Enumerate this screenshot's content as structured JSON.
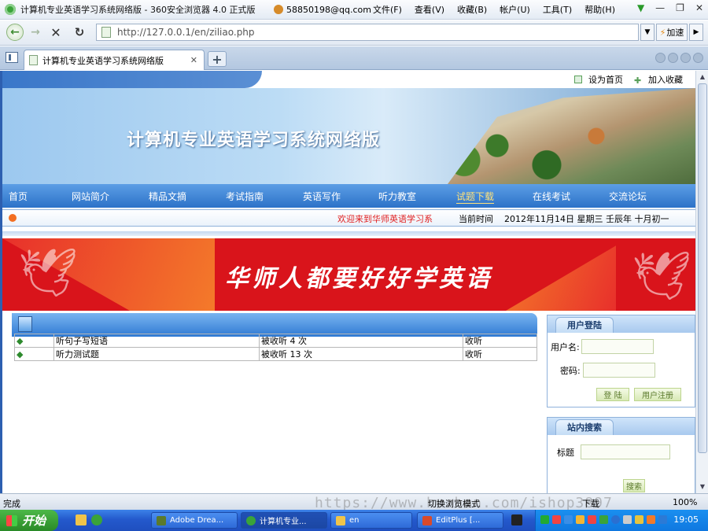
{
  "window": {
    "title": "计算机专业英语学习系统网络版 - 360安全浏览器 4.0 正式版",
    "account": "58850198@qq.com",
    "menu": [
      "文件(F)",
      "查看(V)",
      "收藏(B)",
      "帐户(U)",
      "工具(T)",
      "帮助(H)"
    ]
  },
  "addressbar": {
    "url": "http://127.0.0.1/en/ziliao.php",
    "accelerate_label": "加速"
  },
  "tabs": [
    {
      "label": "计算机专业英语学习系统网络版"
    }
  ],
  "page": {
    "top_links": {
      "set_home": "设为首页",
      "add_favorite": "加入收藏"
    },
    "site_title": "计算机专业英语学习系统网络版",
    "nav": [
      "首页",
      "网站简介",
      "精品文摘",
      "考试指南",
      "英语写作",
      "听力教室",
      "试题下载",
      "在线考试",
      "交流论坛"
    ],
    "active_nav": "试题下载",
    "welcome_marquee": "欢迎来到华师英语学习系",
    "clock_label": "当前时间",
    "clock_value": "2012年11月14日 星期三 壬辰年 十月初一",
    "slogan": "华师人都要好好学英语",
    "list_rows": [
      {
        "bullet": "◆",
        "name": "听句子写短语",
        "count": "被收听 4 次",
        "action": "收听"
      },
      {
        "bullet": "◆",
        "name": "听力测试题",
        "count": "被收听 13 次",
        "action": "收听"
      }
    ],
    "login": {
      "heading": "用户登陆",
      "username_label": "用户名:",
      "password_label": "密码:",
      "login_button": "登 陆",
      "register_button": "用户注册"
    },
    "site_search": {
      "heading": "站内搜索",
      "title_label": "标题",
      "search_button": "搜索"
    }
  },
  "statusbar": {
    "status": "完成",
    "watermark": "https://www.huzhan.com/ishop3897",
    "compat_mode": "切换浏览模式",
    "download": "下载",
    "zoom": "100%"
  },
  "taskbar": {
    "start": "开始",
    "tasks": [
      "Adobe Drea...",
      "计算机专业...",
      "en",
      "EditPlus [..."
    ],
    "clock": "19:05"
  },
  "colors": {
    "nav_blue": "#2c72c8",
    "banner_red": "#d9141b",
    "welcome_red": "#e02020",
    "taskbar_blue": "#2459cc"
  }
}
